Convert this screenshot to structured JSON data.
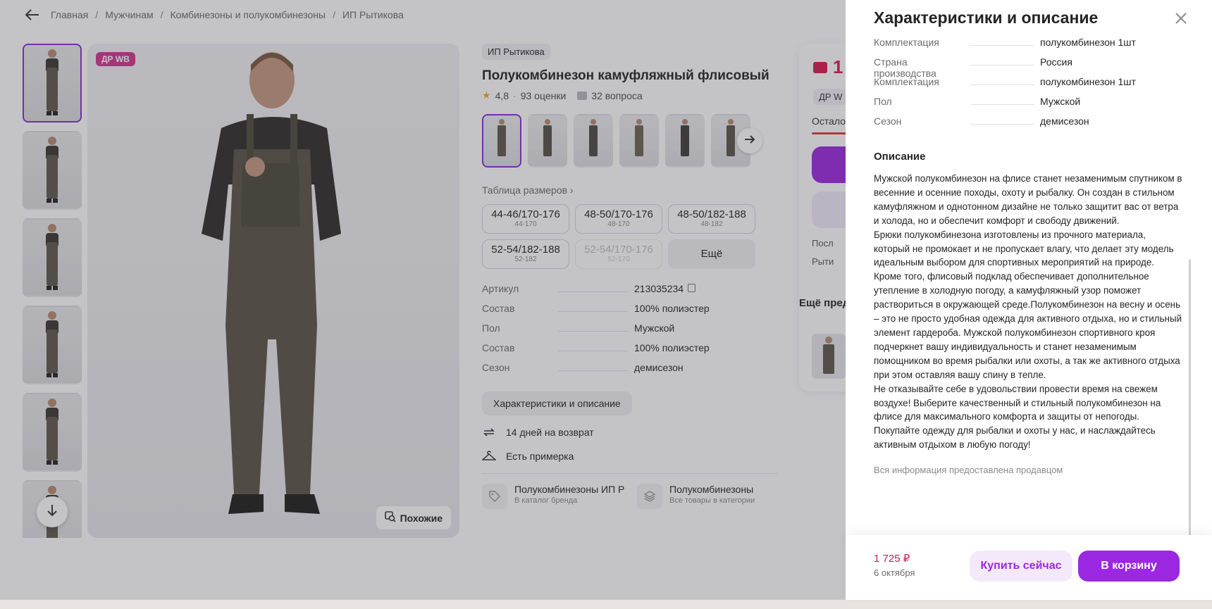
{
  "breadcrumb": {
    "items": [
      "Главная",
      "Мужчинам",
      "Комбинезоны и полукомбинезоны",
      "ИП Рытикова"
    ],
    "separator": "/"
  },
  "gallery": {
    "badge": "ДР WB",
    "similar_label": "Похожие"
  },
  "product": {
    "seller": "ИП Рытикова",
    "title": "Полукомбинезон камуфляжный флисовый",
    "rating": "4,8",
    "rating_sep": "·",
    "reviews": "93 оценки",
    "questions": "32 вопроса",
    "size_table_label": "Таблица размеров ›",
    "sizes": [
      {
        "main": "44-46/170-176",
        "sub": "44-170"
      },
      {
        "main": "48-50/170-176",
        "sub": "48-170"
      },
      {
        "main": "48-50/182-188",
        "sub": "48-182"
      },
      {
        "main": "52-54/182-188",
        "sub": "52-182"
      },
      {
        "main": "52-54/170-176",
        "sub": "52-170"
      }
    ],
    "more_sizes": "Ещё",
    "props": [
      {
        "name": "Артикул",
        "value": "213035234"
      },
      {
        "name": "Состав",
        "value": "100% полиэстер"
      },
      {
        "name": "Пол",
        "value": "Мужской"
      },
      {
        "name": "Состав",
        "value": "100% полиэстер"
      },
      {
        "name": "Сезон",
        "value": "демисезон"
      }
    ],
    "chars_button": "Характеристики и описание",
    "return_text": "14 дней на возврат",
    "fitting_text": "Есть примерка",
    "catalog": [
      {
        "title": "Полукомбинезоны ИП Р",
        "sub": "В каталог бренда"
      },
      {
        "title": "Полукомбинезоны",
        "sub": "Все товары в категории"
      }
    ]
  },
  "price_card": {
    "price": "1",
    "badge": "ДР W",
    "remaining": "Остало",
    "line1": "Посл",
    "line2": "Рыти",
    "more_heading": "Ещё пред"
  },
  "panel": {
    "title": "Характеристики и описание",
    "props": [
      {
        "name": "Комплектация",
        "value": "полукомбинезон 1шт"
      },
      {
        "name": "Страна производства",
        "value": "Россия"
      },
      {
        "name": "Комплектация",
        "value": "полукомбинезон 1шт"
      },
      {
        "name": "Пол",
        "value": "Мужской"
      },
      {
        "name": "Сезон",
        "value": "демисезон"
      }
    ],
    "description_heading": "Описание",
    "description": "Мужской полукомбинезон на флисе станет незаменимым спутником в весенние и осенние походы, охоту и рыбалку. Он создан в стильном камуфляжном и однотонном дизайне не только защитит вас от ветра и холода, но и обеспечит комфорт и свободу движений.\nБрюки полукомбинезона изготовлены из прочного материала, который не промокает и не пропускает влагу, что делает эту модель идеальным выбором для спортивных мероприятий на природе. Кроме того, флисовый подклад обеспечивает дополнительное утепление в холодную погоду, а камуфляжный узор поможет раствориться в окружающей среде.Полукомбинезон на весну и осень – это не просто удобная одежда для активного отдыха, но и стильный элемент гардероба. Мужской полукомбинезон спортивного кроя подчеркнет вашу индивидуальность и станет незаменимым помощником во время рыбалки или охоты, а так же активного отдыха при этом оставляя вашу спину в тепле.\nНе отказывайте себе в удовольствии провести время на свежем воздухе! Выберите качественный и стильный полукомбинезон на флисе для максимального комфорта и защиты от непогоды. Покупайте одежду для рыбалки и охоты у нас, и наслаждайтесь активным отдыхом в любую погоду!",
    "seller_note": "Вся информация предоставлена продавцом",
    "footer_price": "1 725 ₽",
    "footer_date": "6 октября",
    "buy_now": "Купить сейчас",
    "add_to_cart": "В корзину"
  },
  "colors": {
    "accent": "#9b28e0",
    "price": "#c91656",
    "badge": "#d5338f"
  }
}
